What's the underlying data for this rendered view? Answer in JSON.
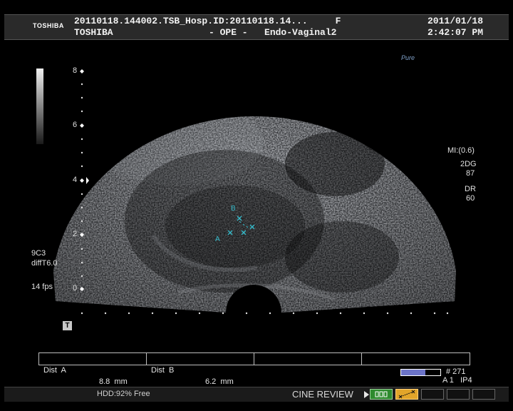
{
  "header": {
    "brand": "TOSHIBA",
    "line1": "20110118.144002.TSB_Hosp.ID:20110118.14...     F",
    "line2_left": "TOSHIBA",
    "line2_mid": "- OPE -   Endo-Vaginal2",
    "date": "2011/01/18",
    "time": "2:42:07 PM"
  },
  "logo": "Pure",
  "depth_scale": {
    "ticks": [
      {
        "label": "8"
      },
      {
        "label": "6"
      },
      {
        "label": "4"
      },
      {
        "label": "2"
      },
      {
        "label": "0"
      }
    ]
  },
  "left_params": {
    "probe": "9C3",
    "mode": "diffT6.0",
    "fps": "14 fps",
    "t_marker": "T"
  },
  "right_params": {
    "mi": "MI:(0.6)",
    "mode": "2DG",
    "gain": "87",
    "dr_label": "DR",
    "dr_value": "60"
  },
  "markers": {
    "a": "A",
    "b": "B"
  },
  "measurements": {
    "dist_a_label": "Dist  A",
    "dist_a_value": "8.8  mm",
    "dist_b_label": "Dist  B",
    "dist_b_value": "6.2  mm"
  },
  "cine": {
    "frame": "# 271",
    "info": "A 1   IP4",
    "progress": 0.62
  },
  "footer": {
    "hdd": "HDD:92% Free",
    "cine_review": "CINE REVIEW"
  },
  "colors": {
    "caliper": "#35b8c8",
    "cine_bar": "#6c74c8",
    "button_green": "#2d8a2d",
    "button_orange": "#e2a52a"
  }
}
